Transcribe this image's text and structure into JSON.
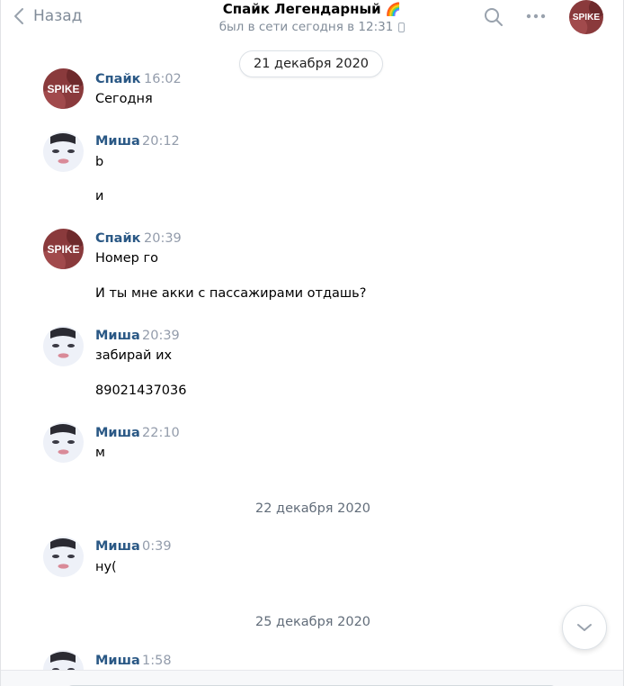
{
  "header": {
    "back_label": "Назад",
    "title": "Спайк Легендарный",
    "title_emoji": "🌈",
    "status": "был в сети сегодня в 12:31"
  },
  "dates": [
    "21 декабря 2020",
    "22 декабря 2020",
    "25 декабря 2020"
  ],
  "messages": [
    {
      "author": "Спайк",
      "time": "16:02",
      "lines": [
        "Сегодня"
      ]
    },
    {
      "author": "Миша",
      "time": "20:12",
      "lines": [
        "b",
        "и"
      ]
    },
    {
      "author": "Спайк",
      "time": "20:39",
      "lines": [
        "Номер го",
        "И ты мне акки с пассажирами отдашь?"
      ]
    },
    {
      "author": "Миша",
      "time": "20:39",
      "lines": [
        "забирай их",
        "89021437036"
      ]
    },
    {
      "author": "Миша",
      "time": "22:10",
      "lines": [
        "м"
      ]
    },
    {
      "author": "Миша",
      "time": "0:39",
      "lines": [
        "ну("
      ]
    },
    {
      "author": "Миша",
      "time": "1:58",
      "lines": []
    }
  ],
  "avatar_text": "SPIKE",
  "colors": {
    "link": "#2a5885",
    "muted": "#818c99",
    "avatar_spike": "#8a3a3c"
  }
}
